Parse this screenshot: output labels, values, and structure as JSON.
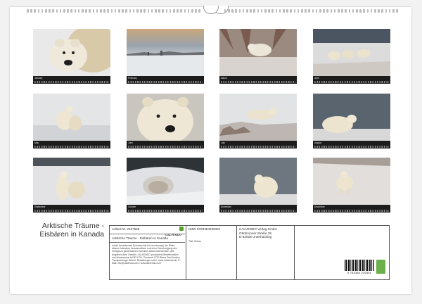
{
  "months": [
    {
      "id": "jan",
      "label": "January",
      "scene": "closeup-snow"
    },
    {
      "id": "feb",
      "label": "February",
      "scene": "sunset-tundra"
    },
    {
      "id": "mar",
      "label": "March",
      "scene": "bush-bear"
    },
    {
      "id": "apr",
      "label": "April",
      "scene": "three-bears"
    },
    {
      "id": "may",
      "label": "May",
      "scene": "two-bears-play"
    },
    {
      "id": "jun",
      "label": "June",
      "scene": "closeup-face"
    },
    {
      "id": "jul",
      "label": "July",
      "scene": "lying-bear"
    },
    {
      "id": "aug",
      "label": "August",
      "scene": "resting-water"
    },
    {
      "id": "sep",
      "label": "September",
      "scene": "two-bears-standing"
    },
    {
      "id": "oct",
      "label": "October",
      "scene": "snow-den"
    },
    {
      "id": "nov",
      "label": "November",
      "scene": "sitting-water"
    },
    {
      "id": "dec",
      "label": "December",
      "scene": "walking-bear"
    }
  ],
  "title": "Arktische Träume - Eisbären in Kanada",
  "info": {
    "artikel": "Artikel-Nr. 2467556",
    "calvendo": "CALVENDO",
    "subtitle": "Arktische Träume - Eisbären in Kanada",
    "body": "Inhalt: bezahlender Schutzrechte ist es untersagt, die Bilder dieses Kalenders herauszulösen und ohne Genehmigung des Verlags zu gewerblichen Zwecken weiterzuverwenden. Alle Angaben ohne Gewähr. CALVENDO produziert klimafreundlich und klimaneutral in DE & EU. Printwerk CO2-Bilanz Seid Auction Transportwege. Abhah. Bestellungen unter: www.calvendo.de. E-Mail: info@calvendo.com / www.calvendo.com",
    "isbn": "ISBN 9783384239391",
    "publisher": [
      "CALVENDO Verlag GmbH",
      "Ottobrunner Straße 39",
      "D-82008 Unterhaching"
    ],
    "photographer": "Titel: Schau",
    "barcode_number": "9 783384 239391"
  },
  "colors": {
    "strip": "#1c1c1c",
    "eco": "#6ab04c",
    "sheet": "#ffffff"
  }
}
